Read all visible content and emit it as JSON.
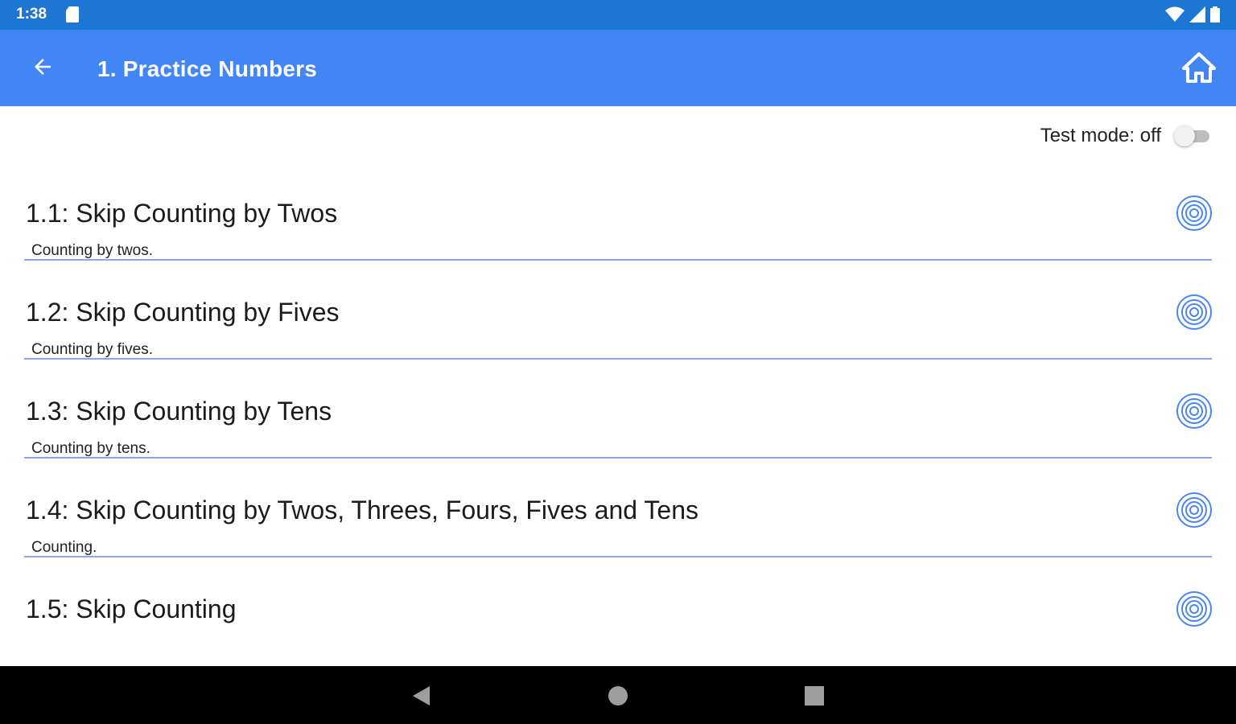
{
  "status_bar": {
    "time": "1:38",
    "icons": [
      "sd-card-icon",
      "wifi-icon",
      "signal-icon",
      "battery-icon"
    ]
  },
  "app_bar": {
    "title": "1. Practice Numbers",
    "back_icon": "arrow-back-icon",
    "home_icon": "home-icon"
  },
  "test_mode": {
    "label": "Test mode: off",
    "enabled": false
  },
  "lessons": [
    {
      "title": "1.1: Skip Counting by Twos",
      "subtitle": "Counting by twos.",
      "icon": "target-icon"
    },
    {
      "title": "1.2: Skip Counting by Fives",
      "subtitle": "Counting by fives.",
      "icon": "target-icon"
    },
    {
      "title": "1.3: Skip Counting by Tens",
      "subtitle": "Counting by tens.",
      "icon": "target-icon"
    },
    {
      "title": "1.4: Skip Counting by Twos, Threes, Fours, Fives and Tens",
      "subtitle": "Counting.",
      "icon": "target-icon"
    },
    {
      "title": "1.5: Skip Counting",
      "subtitle": "",
      "icon": "target-icon"
    }
  ],
  "nav_bar": {
    "icons": [
      "back-triangle-icon",
      "home-circle-icon",
      "recents-square-icon"
    ]
  },
  "colors": {
    "status_bar": "#1c76d2",
    "app_bar": "#4285f4",
    "divider": "#8aa6ef",
    "target": "#4a86f0"
  }
}
